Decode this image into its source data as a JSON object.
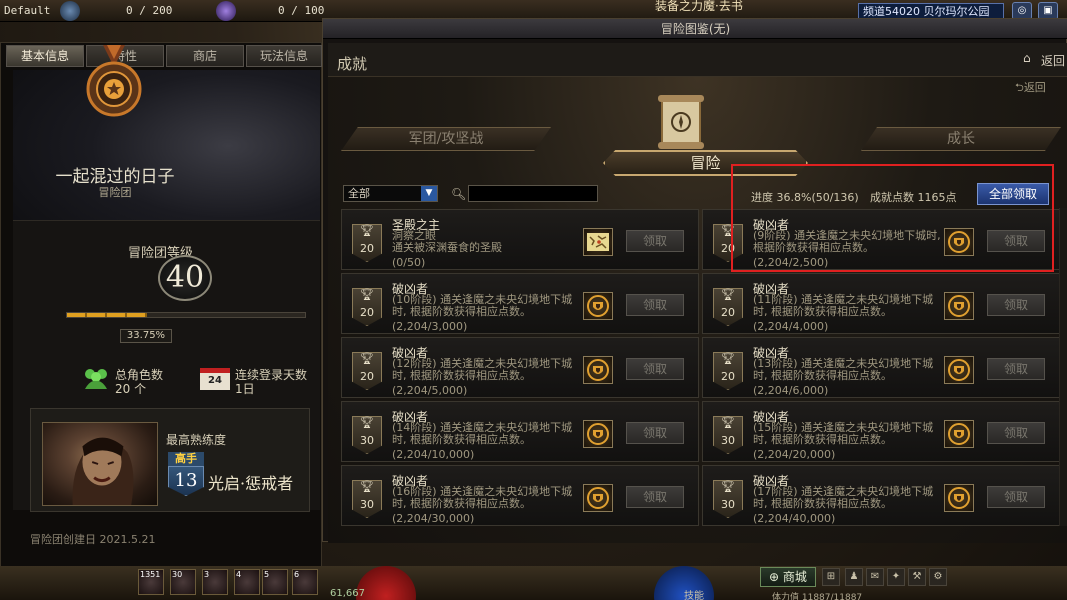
{
  "hud": {
    "player_label": "Default",
    "stat1": "0  /  200",
    "stat2": "0  /  100",
    "map_name": "装备之力魔·去书",
    "channel": "频道54020 贝尔玛尔公园"
  },
  "left_panel": {
    "tabs": [
      "基本信息",
      "特性",
      "商店",
      "玩法信息"
    ],
    "active_tab": 0,
    "guild_name": "一起混过的日子",
    "guild_type": "冒险团",
    "level_label": "冒险团等级",
    "level": "40",
    "xp_percent": "33.75%",
    "xp_fraction": 0.3375,
    "stat_characters_label": "总角色数",
    "stat_characters_value": "20 个",
    "calendar_icon_text": "24",
    "stat_login_label": "连续登录天数",
    "stat_login_value": "1日",
    "proficiency_label": "最高熟练度",
    "rank_badge": "高手",
    "rank_level": "13",
    "char_class": "光启·惩戒者",
    "created_label": "冒险团创建日  2021.5.21"
  },
  "main": {
    "window_title": "冒险图鉴(无)",
    "section_title": "成就",
    "back_label": "返回",
    "back_label_2": "返回",
    "category_tabs": [
      "军团/攻坚战",
      "冒险",
      "成长"
    ],
    "active_category": 1,
    "filter_value": "全部",
    "search_placeholder": "",
    "progress_text": "进度  36.8%(50/136)",
    "points_text": "成就点数  1165点",
    "claim_all_label": "全部领取",
    "claim_label": "领取"
  },
  "achievements": [
    {
      "title": "圣殿之主",
      "desc": "洞察之眼\n通关被深渊蚕食的圣殿",
      "progress": "(0/50)",
      "level": "20",
      "reward": "map-icon"
    },
    {
      "title": "破凶者",
      "desc": "(9阶段) 通关逢魔之未央幻境地下城时, 根据阶数获得相应点数。",
      "progress": "(2,204/2,500)",
      "level": "20",
      "reward": "shield-icon"
    },
    {
      "title": "破凶者",
      "desc": "(10阶段) 通关逢魔之未央幻境地下城时, 根据阶数获得相应点数。",
      "progress": "(2,204/3,000)",
      "level": "20",
      "reward": "shield-icon"
    },
    {
      "title": "破凶者",
      "desc": "(11阶段) 通关逢魔之未央幻境地下城时, 根据阶数获得相应点数。",
      "progress": "(2,204/4,000)",
      "level": "20",
      "reward": "shield-icon"
    },
    {
      "title": "破凶者",
      "desc": "(12阶段) 通关逢魔之未央幻境地下城时, 根据阶数获得相应点数。",
      "progress": "(2,204/5,000)",
      "level": "20",
      "reward": "shield-icon"
    },
    {
      "title": "破凶者",
      "desc": "(13阶段) 通关逢魔之未央幻境地下城时, 根据阶数获得相应点数。",
      "progress": "(2,204/6,000)",
      "level": "20",
      "reward": "shield-icon"
    },
    {
      "title": "破凶者",
      "desc": "(14阶段) 通关逢魔之未央幻境地下城时, 根据阶数获得相应点数。",
      "progress": "(2,204/10,000)",
      "level": "30",
      "reward": "shield-icon"
    },
    {
      "title": "破凶者",
      "desc": "(15阶段) 通关逢魔之未央幻境地下城时, 根据阶数获得相应点数。",
      "progress": "(2,204/20,000)",
      "level": "30",
      "reward": "shield-icon"
    },
    {
      "title": "破凶者",
      "desc": "(16阶段) 通关逢魔之未央幻境地下城时, 根据阶数获得相应点数。",
      "progress": "(2,204/30,000)",
      "level": "30",
      "reward": "shield-icon"
    },
    {
      "title": "破凶者",
      "desc": "(17阶段) 通关逢魔之未央幻境地下城时, 根据阶数获得相应点数。",
      "progress": "(2,204/40,000)",
      "level": "30",
      "reward": "shield-icon"
    }
  ],
  "bottom": {
    "slot_numbers": [
      "1351",
      "30",
      "3",
      "4",
      "5",
      "6"
    ],
    "gold": "61,667",
    "skill_label": "技能",
    "shop_label": "商城",
    "status_text": "体力值  11887/11887"
  },
  "colors": {
    "accent_gold": "#c8a870",
    "highlight_red": "#e02020",
    "claim_blue": "#2a58a0"
  }
}
